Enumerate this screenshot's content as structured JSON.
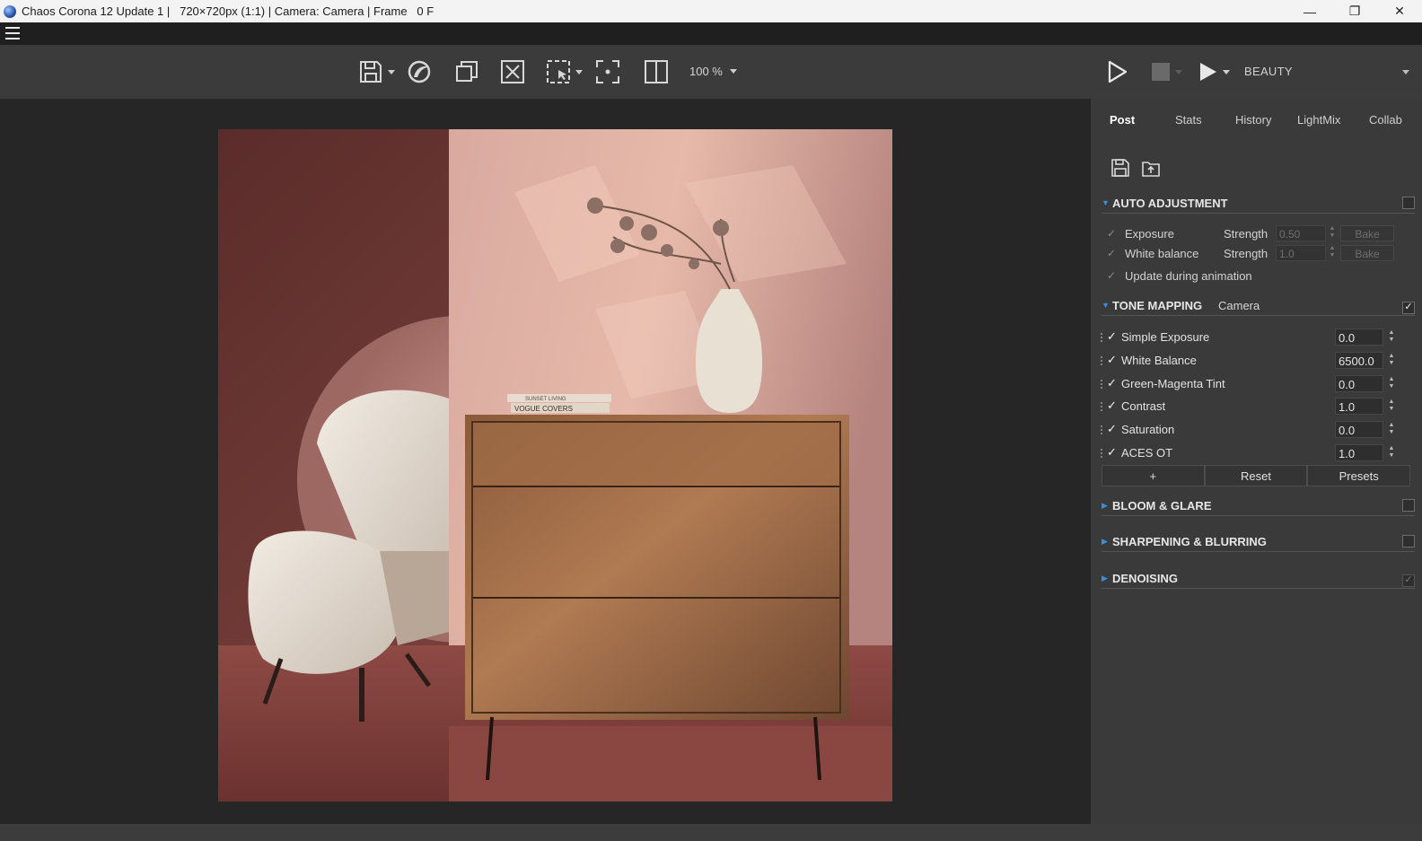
{
  "window": {
    "title": "Chaos Corona 12 Update 1 |   720×720px (1:1) | Camera: Camera | Frame   0 F",
    "minimize": "—",
    "restore": "❐",
    "close": "✕"
  },
  "toolbar": {
    "zoom": "100 %",
    "pass": "BEAUTY",
    "icons": [
      "save-icon",
      "corona-logo-icon",
      "copy-icon",
      "clear-icon",
      "region-select-icon",
      "focus-icon",
      "split-view-icon",
      "play-icon",
      "stop-icon",
      "render-icon"
    ]
  },
  "panel": {
    "tabs": [
      "Post",
      "Stats",
      "History",
      "LightMix",
      "Collab"
    ],
    "active_tab": "Post",
    "auto_adjustment": {
      "title": "AUTO ADJUSTMENT",
      "enabled": false,
      "rows": [
        {
          "label": "Exposure",
          "strength_label": "Strength",
          "strength": "0.50",
          "bake": "Bake"
        },
        {
          "label": "White balance",
          "strength_label": "Strength",
          "strength": "1.0",
          "bake": "Bake"
        }
      ],
      "update_label": "Update during animation"
    },
    "tone_mapping": {
      "title": "TONE MAPPING",
      "source": "Camera",
      "enabled": true,
      "rows": [
        {
          "label": "Simple Exposure",
          "value": "0.0",
          "checked": true
        },
        {
          "label": "White Balance",
          "value": "6500.0",
          "checked": true
        },
        {
          "label": "Green-Magenta Tint",
          "value": "0.0",
          "checked": true
        },
        {
          "label": "Contrast",
          "value": "1.0",
          "checked": true
        },
        {
          "label": "Saturation",
          "value": "0.0",
          "checked": true
        },
        {
          "label": "ACES OT",
          "value": "1.0",
          "checked": true
        }
      ],
      "buttons": {
        "add": "+",
        "reset": "Reset",
        "presets": "Presets"
      }
    },
    "sections": [
      {
        "title": "BLOOM & GLARE",
        "enabled": false
      },
      {
        "title": "SHARPENING & BLURRING",
        "enabled": false
      },
      {
        "title": "DENOISING",
        "enabled": true
      }
    ]
  },
  "render": {
    "book_top": "SUNSET LIVING",
    "book_bottom": "VOGUE COVERS"
  },
  "colors": {
    "accent": "#3b8de0",
    "panel_bg": "#3a3a3a",
    "viewport_bg": "#262626"
  }
}
